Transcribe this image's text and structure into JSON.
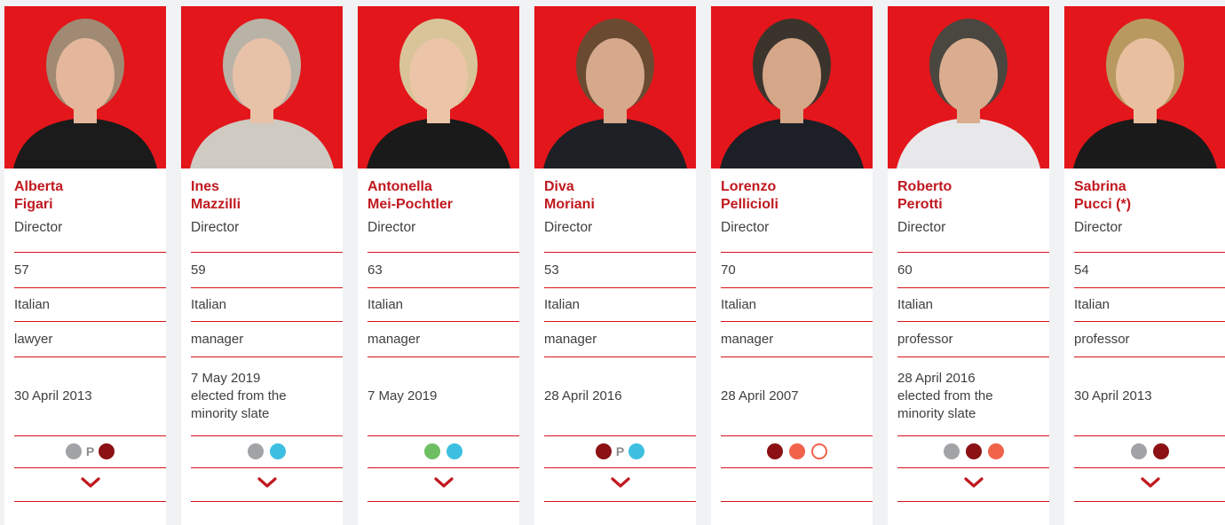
{
  "directors": [
    {
      "first_name": "Alberta",
      "last_name": "Figari",
      "role": "Director",
      "age": "57",
      "nationality": "Italian",
      "profession": "lawyer",
      "appointed": [
        "30 April 2013"
      ],
      "committees": [
        "grey",
        "P",
        "darkred"
      ],
      "checked": true
    },
    {
      "first_name": "Ines",
      "last_name": "Mazzilli",
      "role": "Director",
      "age": "59",
      "nationality": "Italian",
      "profession": "manager",
      "appointed": [
        "7 May 2019",
        "elected from the",
        "minority slate"
      ],
      "committees": [
        "grey",
        "blue"
      ],
      "checked": true
    },
    {
      "first_name": "Antonella",
      "last_name": "Mei-Pochtler",
      "role": "Director",
      "age": "63",
      "nationality": "Italian",
      "profession": "manager",
      "appointed": [
        "7 May 2019"
      ],
      "committees": [
        "green",
        "blue"
      ],
      "checked": true
    },
    {
      "first_name": "Diva",
      "last_name": "Moriani",
      "role": "Director",
      "age": "53",
      "nationality": "Italian",
      "profession": "manager",
      "appointed": [
        "28 April 2016"
      ],
      "committees": [
        "darkred",
        "P",
        "blue"
      ],
      "checked": true
    },
    {
      "first_name": "Lorenzo",
      "last_name": "Pellicioli",
      "role": "Director",
      "age": "70",
      "nationality": "Italian",
      "profession": "manager",
      "appointed": [
        "28 April 2007"
      ],
      "committees": [
        "darkred",
        "orange",
        "outline-orange"
      ],
      "checked": false
    },
    {
      "first_name": "Roberto",
      "last_name": "Perotti",
      "role": "Director",
      "age": "60",
      "nationality": "Italian",
      "profession": "professor",
      "appointed": [
        "28 April 2016",
        "elected from the",
        "minority slate"
      ],
      "committees": [
        "grey",
        "darkred",
        "orange"
      ],
      "checked": true
    },
    {
      "first_name": "Sabrina",
      "last_name": "Pucci (*)",
      "role": "Director",
      "age": "54",
      "nationality": "Italian",
      "profession": "professor",
      "appointed": [
        "30 April 2013"
      ],
      "committees": [
        "grey",
        "darkred"
      ],
      "checked": true
    }
  ],
  "colors": {
    "accent_red": "#e3161b",
    "name_red": "#c0191f",
    "rule_red": "#d5141a",
    "grey": "#a1a3a6",
    "darkred": "#8b1114",
    "blue": "#3dbfe1",
    "green": "#6ebf64",
    "orange": "#f0624a"
  },
  "icons": {
    "checked": "checkmark-icon",
    "portrait": "portrait-photo"
  }
}
